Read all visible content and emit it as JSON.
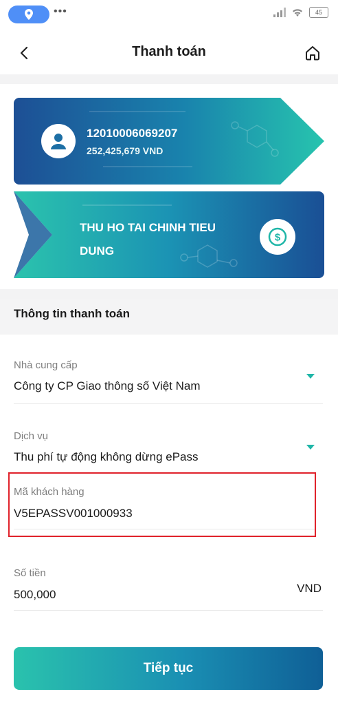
{
  "status_bar": {
    "battery": "45",
    "dots": "•••"
  },
  "header": {
    "title": "Thanh toán"
  },
  "account": {
    "number": "12010006069207",
    "balance": "252,425,679 VND"
  },
  "service": {
    "name": "THU HO TAI CHINH TIEU DUNG"
  },
  "section": {
    "title": "Thông tin thanh toán"
  },
  "fields": {
    "provider": {
      "label": "Nhà cung cấp",
      "value": "Công ty CP Giao thông số Việt Nam"
    },
    "service": {
      "label": "Dịch vụ",
      "value": "Thu phí tự động không dừng ePass"
    },
    "customer_code": {
      "label": "Mã khách hàng",
      "value": "V5EPASSV001000933"
    },
    "amount": {
      "label": "Số tiền",
      "value": "500,000",
      "currency": "VND"
    }
  },
  "actions": {
    "continue": "Tiếp tục"
  },
  "colors": {
    "accent": "#1fb6a8",
    "card_dark": "#1a5e9b",
    "highlight": "#e0222b"
  },
  "icons": [
    "location-icon",
    "signal-icon",
    "wifi-icon",
    "battery-icon",
    "back-arrow-icon",
    "home-icon",
    "user-icon",
    "dollar-icon",
    "chevron-down-icon"
  ]
}
